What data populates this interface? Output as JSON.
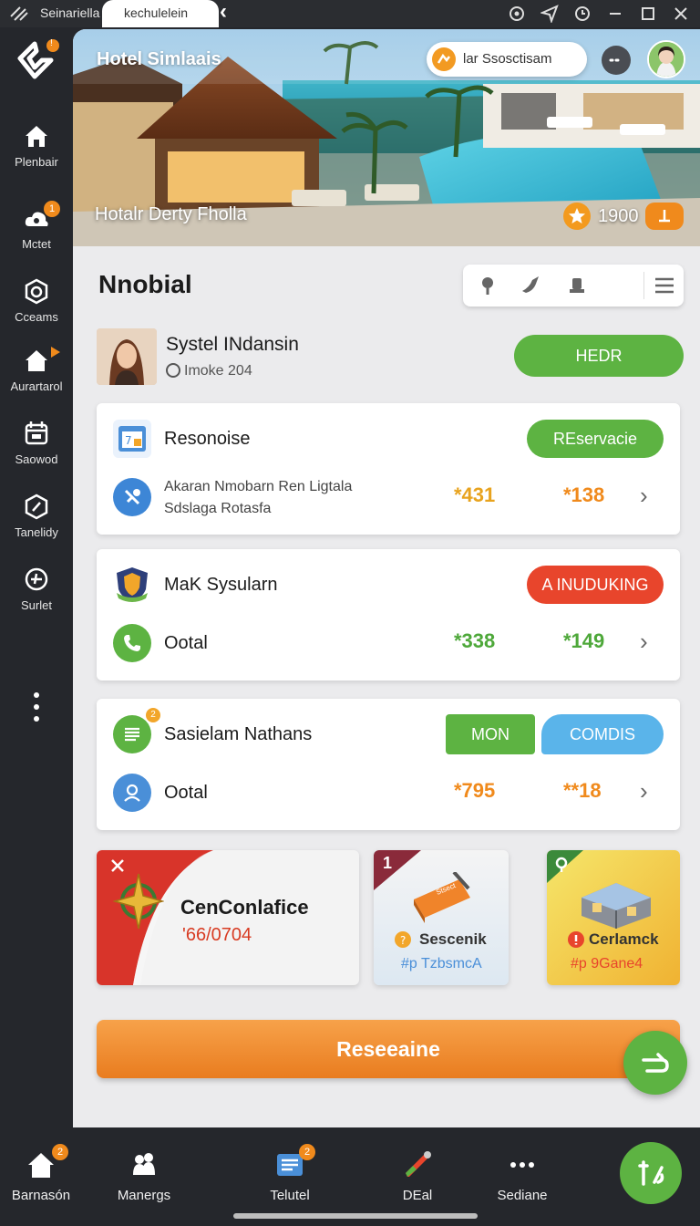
{
  "titlebar": {
    "app_name": "Seinariella",
    "tab_label": "kechulelein",
    "icons": [
      "grip-icon",
      "settings-icon",
      "send-icon",
      "history-icon",
      "minimize-icon",
      "maximize-icon",
      "close-icon"
    ]
  },
  "sidebar": {
    "logo_badge": "!",
    "items": [
      {
        "label": "Plenbair",
        "icon": "home-icon",
        "badge": ""
      },
      {
        "label": "Mctet",
        "icon": "cloud-user-icon",
        "badge": "1"
      },
      {
        "label": "Cceams",
        "icon": "camera-icon",
        "badge": ""
      },
      {
        "label": "Aurartarol",
        "icon": "house-icon",
        "badge": ""
      },
      {
        "label": "Saowod",
        "icon": "calendar-icon",
        "badge": ""
      },
      {
        "label": "Tanelidy",
        "icon": "hexagon-icon",
        "badge": ""
      },
      {
        "label": "Surlet",
        "icon": "globe-icon",
        "badge": ""
      }
    ]
  },
  "hero": {
    "title": "Hotel Simlaais",
    "search_placeholder": "lar Ssosctisam",
    "caption": "Hotalr Derty Fholla",
    "rating": "1900"
  },
  "section": {
    "title": "Nnobial"
  },
  "profile": {
    "name": "Systel INdansin",
    "subtitle": "Imoke 204",
    "button": "HEDR"
  },
  "cards": [
    {
      "title": "Resonoise",
      "line1": "Akaran Nmobarn Ren Ligtala",
      "line2": "Sdslaga Rotasfa",
      "pill": "REservacie",
      "value1": "*431",
      "value2": "*138",
      "value1_color": "#e8a31e",
      "value2_color": "#f08a1c"
    },
    {
      "title": "MaK Sysularn",
      "line1": "Ootal",
      "pill": "A INUDUKING",
      "value1": "*338",
      "value2": "*149",
      "value1_color": "#4ea83a",
      "value2_color": "#4ea83a"
    },
    {
      "title": "Sasielam Nathans",
      "title_badge": "2",
      "line1": "Ootal",
      "pill_a": "MON",
      "pill_b": "COMDIS",
      "value1": "*795",
      "value2": "**18",
      "value1_color": "#f08a1c",
      "value2_color": "#f08a1c"
    }
  ],
  "promos": [
    {
      "title": "CenConlafice",
      "code": "'66/0704"
    },
    {
      "corner": "1",
      "label": "Sescenik",
      "sub": "#p TzbsmcA",
      "item_text": "Stsect"
    },
    {
      "label": "Cerlamck",
      "sub": "#p 9Gane4"
    }
  ],
  "cta": {
    "label": "Reseeaine"
  },
  "bottom_nav": [
    {
      "label": "Barnasón",
      "icon": "home-icon",
      "badge": "2"
    },
    {
      "label": "Manergs",
      "icon": "people-icon",
      "badge": ""
    },
    {
      "label": "Telutel",
      "icon": "list-icon",
      "badge": "2"
    },
    {
      "label": "DEal",
      "icon": "pen-icon",
      "badge": ""
    },
    {
      "label": "Sediane",
      "icon": "more-icon",
      "badge": ""
    }
  ],
  "colors": {
    "accent_orange": "#f08a1c",
    "accent_green": "#5db342",
    "accent_red": "#e8452c",
    "accent_blue": "#5ab4ea"
  }
}
